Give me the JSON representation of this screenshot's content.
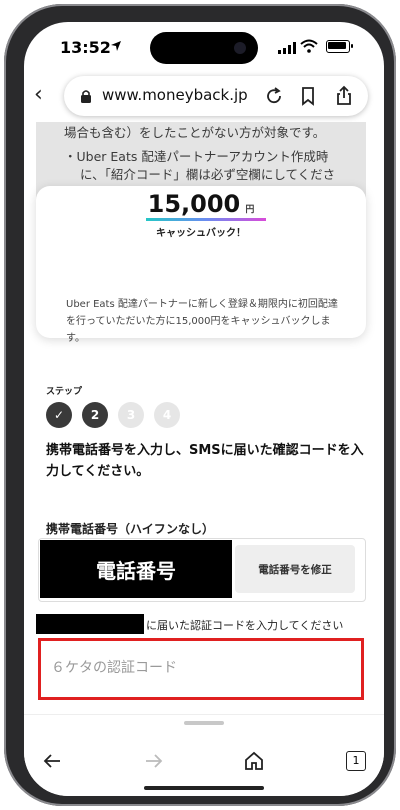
{
  "status": {
    "time": "13:52"
  },
  "browser": {
    "url": "www.moneyback.jp"
  },
  "page": {
    "bg_lines": [
      "場合も含む）をしたことがない方が対象です。",
      "・Uber Eats 配達パートナーアカウント作成時",
      "に、「紹介コード」欄は必ず空欄にしてくださ"
    ],
    "amount": "15,000",
    "currency": "円",
    "cashback_label": "キャッシュバック！",
    "description": "Uber Eats 配達パートナーに新しく登録＆期限内に初回配達を行っていただいた方に15,000円をキャッシュバックします。",
    "step_label": "ステップ",
    "steps": [
      "✓",
      "2",
      "3",
      "4"
    ],
    "instruction": "携帯電話番号を入力し、SMSに届いた確認コードを入力してください。",
    "phone_label": "携帯電話番号（ハイフンなし）",
    "phone_value": "電話番号",
    "edit_phone": "電話番号を修正",
    "sms_text": "に届いた認証コードを入力してください",
    "code_placeholder": "６ケタの認証コード"
  },
  "toolbar": {
    "tabs_count": "1"
  },
  "colors": {
    "highlight_border": "#e02020",
    "step_active": "#3a3a3a"
  }
}
